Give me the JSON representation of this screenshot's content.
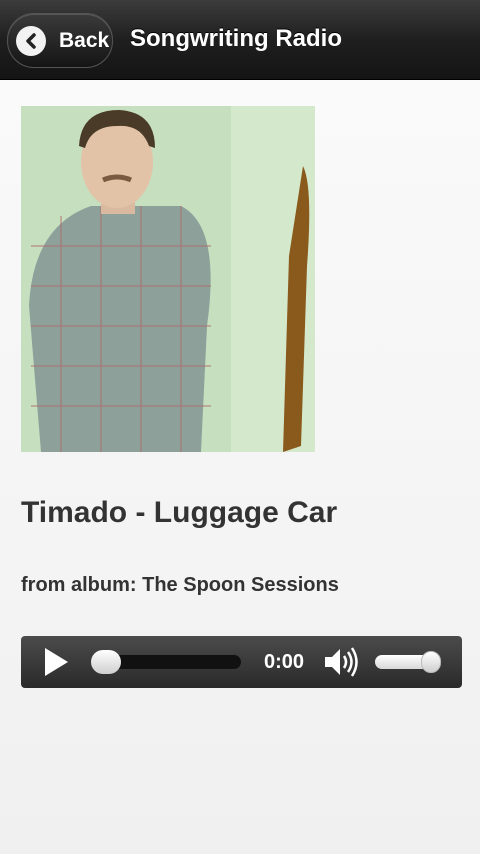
{
  "header": {
    "back_label": "Back",
    "title": "Songwriting Radio"
  },
  "track": {
    "title": "Timado - Luggage Car",
    "album_line": "from album: The Spoon Sessions"
  },
  "player": {
    "time": "0:00",
    "progress_fraction": 0.0,
    "volume_fraction": 1.0
  },
  "icons": [
    "back-arrow-icon",
    "play-icon",
    "volume-icon"
  ],
  "colors": {
    "header_bg": "#1f1f1f",
    "player_bg": "#3a3a3a",
    "text_dark": "#333333"
  }
}
